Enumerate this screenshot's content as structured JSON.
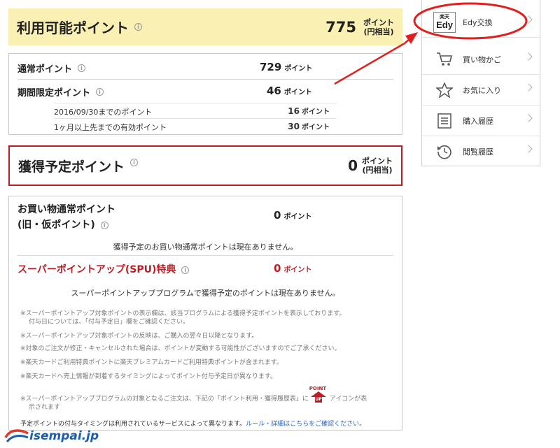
{
  "available": {
    "title": "利用可能ポイント",
    "value": "775",
    "unit_line1": "ポイント",
    "unit_line2": "(円相当)"
  },
  "points": {
    "normal_label": "通常ポイント",
    "normal_value": "729",
    "limited_label": "期間限定ポイント",
    "limited_value": "46",
    "unit": "ポイント",
    "sub": [
      {
        "label": "2016/09/30までのポイント",
        "value": "16"
      },
      {
        "label": "1ヶ月以上先までの有効ポイント",
        "value": "30"
      }
    ]
  },
  "expected": {
    "title": "獲得予定ポイント",
    "value": "0",
    "unit_line1": "ポイント",
    "unit_line2": "(円相当)"
  },
  "detail": {
    "shop_title_line1": "お買い物通常ポイント",
    "shop_title_line2": "(旧・仮ポイント)",
    "shop_value": "0",
    "shop_message": "獲得予定のお買い物通常ポイントは現在ありません。",
    "spu_title": "スーパーポイントアップ(SPU)特典",
    "spu_value": "0",
    "spu_message": "スーパーポイントアッププログラムで獲得予定のポイントは現在ありません。",
    "unit": "ポイント",
    "notes": [
      "※スーパーポイントアップ対象ポイントの表示欄は、該当プログラムによる獲得予定ポイントを表示しております。",
      "付与日については、「付与予定日」欄をご確認ください。",
      "※スーパーポイントアップ対象ポイントの反映は、ご購入の翌々日以降となります。",
      "※対象のご注文が修正・キャンセルされた場合は、ポイントが変動する可能性がございますのでご了承ください。",
      "※楽天カードご利用特典ポイントに楽天プレミアムカードご利用特典ポイントが含まれます。",
      "※楽天カードへ売上情報が到着するタイミングによってポイント付与予定日が異なります。"
    ],
    "note_up_before": "※スーパーポイントアッププログラムの対象となるご注文は、下記の「ポイント利用・獲得履歴表」に",
    "note_up_after": "アイコンが表",
    "note_up_line2": "示されます",
    "point_badge_label": "POINT",
    "up_badge_label": "UP",
    "timing_text": "予定ポイントの付与タイミングは利用されているサービスによって異なります。",
    "timing_link1": "ルール・詳細は",
    "timing_link2": "こちらをご確認ください。"
  },
  "menu": {
    "items": [
      {
        "label": "Edy交換",
        "icon": "edy-logo-icon"
      },
      {
        "label": "買い物かご",
        "icon": "cart-icon"
      },
      {
        "label": "お気に入り",
        "icon": "star-icon"
      },
      {
        "label": "購入履歴",
        "icon": "list-icon"
      },
      {
        "label": "閲覧履歴",
        "icon": "history-icon"
      }
    ],
    "edy_logo_top": "楽天",
    "edy_logo_bottom": "Edy"
  },
  "watermark": "isempai.jp",
  "colors": {
    "highlight_bg": "#fbf0b3",
    "accent_red": "#bb1f25",
    "annotation_red": "#e0201e",
    "link_blue": "#2a66c4"
  }
}
